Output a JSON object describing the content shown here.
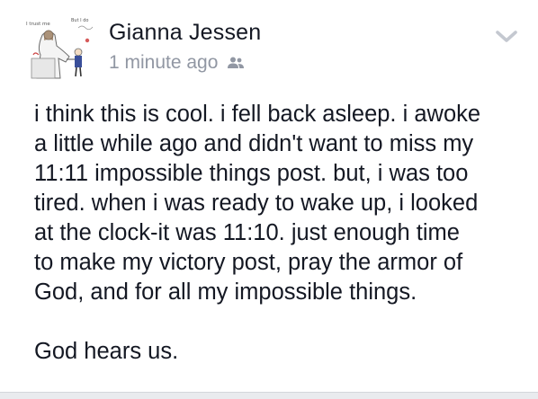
{
  "post": {
    "author": "Gianna Jessen",
    "timestamp": "1 minute ago",
    "audience_icon": "friends-icon",
    "menu_icon": "chevron-down-icon",
    "avatar": {
      "caption_left": "I trust me",
      "caption_right": "But I do"
    },
    "body_lines": [
      "i think this is cool. i fell back asleep. i awoke",
      "a little while ago and didn't want to miss my",
      "11:11 impossible things post. but, i was too",
      "tired. when i was ready to wake up, i looked",
      "at the clock-it was 11:10. just enough time",
      "to make my victory post, pray the armor of",
      "God, and for all my impossible things."
    ],
    "closing_line": "God hears us."
  },
  "colors": {
    "name": "#141823",
    "meta": "#9197a3",
    "background": "#e9ebee",
    "card": "#ffffff"
  }
}
